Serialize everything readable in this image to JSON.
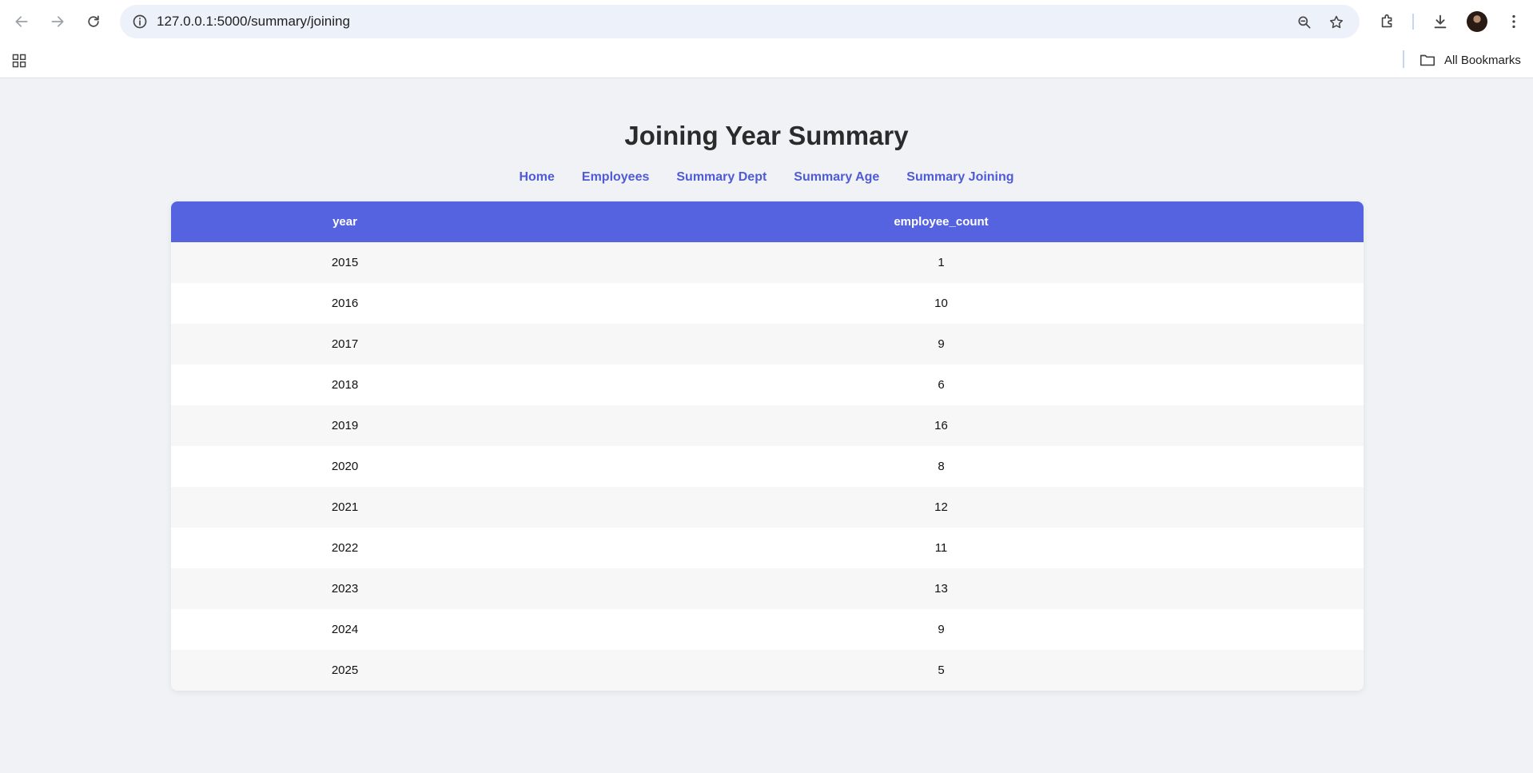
{
  "browser": {
    "url": "127.0.0.1:5000/summary/joining",
    "bookmarks_label": "All Bookmarks"
  },
  "page": {
    "title": "Joining Year Summary",
    "nav": [
      {
        "label": "Home"
      },
      {
        "label": "Employees"
      },
      {
        "label": "Summary Dept"
      },
      {
        "label": "Summary Age"
      },
      {
        "label": "Summary Joining"
      }
    ]
  },
  "table": {
    "columns": [
      "year",
      "employee_count"
    ],
    "rows": [
      [
        "2015",
        "1"
      ],
      [
        "2016",
        "10"
      ],
      [
        "2017",
        "9"
      ],
      [
        "2018",
        "6"
      ],
      [
        "2019",
        "16"
      ],
      [
        "2020",
        "8"
      ],
      [
        "2021",
        "12"
      ],
      [
        "2022",
        "11"
      ],
      [
        "2023",
        "13"
      ],
      [
        "2024",
        "9"
      ],
      [
        "2025",
        "5"
      ]
    ]
  },
  "colors": {
    "header_bg": "#5663e0",
    "link": "#4f5bd5",
    "page_bg": "#f0f2f5"
  }
}
